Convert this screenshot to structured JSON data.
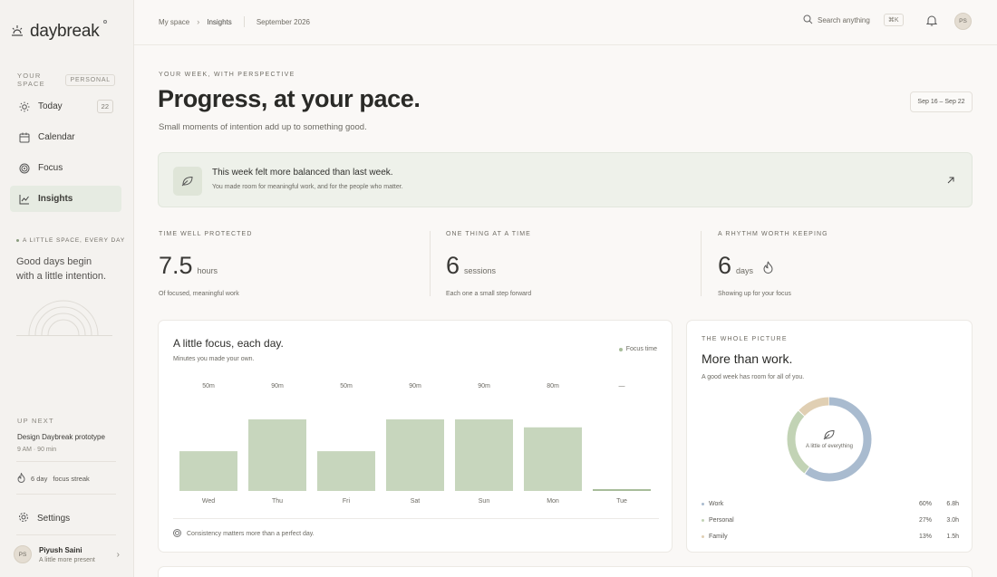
{
  "app": {
    "name": "daybreak"
  },
  "sidebar": {
    "space_label": "YOUR SPACE",
    "space_pill": "PERSONAL",
    "items": [
      {
        "label": "Today",
        "icon": "sun-icon",
        "badge": "22",
        "active": false
      },
      {
        "label": "Calendar",
        "icon": "calendar-icon",
        "active": false
      },
      {
        "label": "Focus",
        "icon": "target-icon",
        "active": false
      },
      {
        "label": "Insights",
        "icon": "chart-icon",
        "active": true
      }
    ],
    "quote_tag": "A LITTLE SPACE, EVERY DAY",
    "quote_line1": "Good days begin",
    "quote_line2": "with a little intention.",
    "upnext_label": "UP NEXT",
    "upnext_title": "Design Daybreak prototype",
    "upnext_time": "9 AM · 90 min",
    "streak_num": "6 day",
    "streak_text": "focus streak",
    "settings_label": "Settings",
    "profile": {
      "initials": "PS",
      "name": "Piyush Saini",
      "subtitle": "A little more present"
    }
  },
  "topbar": {
    "crumb1": "My space",
    "crumb2": "Insights",
    "period": "September 2026",
    "search_placeholder": "Search anything",
    "shortcut": "⌘K",
    "avatar_initials": "PS"
  },
  "header": {
    "eyebrow": "YOUR WEEK, WITH PERSPECTIVE",
    "title": "Progress, at your pace.",
    "subtitle": "Small moments of intention add up to something good.",
    "date_range": "Sep 16 – Sep 22"
  },
  "banner": {
    "title": "This week felt more balanced than last week.",
    "subtitle": "You made room for meaningful work, and for the people who matter."
  },
  "stats": [
    {
      "label": "TIME WELL PROTECTED",
      "value": "7.5",
      "unit": "hours",
      "note": "Of focused, meaningful work"
    },
    {
      "label": "ONE THING AT A TIME",
      "value": "6",
      "unit": "sessions",
      "note": "Each one a small step forward"
    },
    {
      "label": "A RHYTHM WORTH KEEPING",
      "value": "6",
      "unit": "days",
      "note": "Showing up for your focus"
    }
  ],
  "focus_card": {
    "title": "A little focus, each day.",
    "subtitle": "Minutes you made your own.",
    "legend": "Focus time",
    "footer": "Consistency matters more than a perfect day."
  },
  "chart_data": {
    "type": "bar",
    "categories": [
      "Wed",
      "Thu",
      "Fri",
      "Sat",
      "Sun",
      "Mon",
      "Tue"
    ],
    "values": [
      50,
      90,
      50,
      90,
      90,
      80,
      0
    ],
    "data_labels": [
      "50m",
      "90m",
      "50m",
      "90m",
      "90m",
      "80m",
      "—"
    ],
    "series": [
      {
        "name": "Focus time",
        "values": [
          50,
          90,
          50,
          90,
          90,
          80,
          0
        ]
      }
    ],
    "color": "#c7d6bd",
    "grid": false,
    "legend": "top-right"
  },
  "picture_card": {
    "eyebrow": "THE WHOLE PICTURE",
    "title": "More than work.",
    "subtitle": "A good week has room for all of you.",
    "center_text": "A little of everything",
    "rows": [
      {
        "label": "Work",
        "pct": "60%",
        "hours": "6.8h",
        "value": 60,
        "color": "#a9bbcf"
      },
      {
        "label": "Personal",
        "pct": "27%",
        "hours": "3.0h",
        "value": 27,
        "color": "#c2d3b5"
      },
      {
        "label": "Family",
        "pct": "13%",
        "hours": "1.5h",
        "value": 13,
        "color": "#e0cfb3"
      }
    ]
  }
}
